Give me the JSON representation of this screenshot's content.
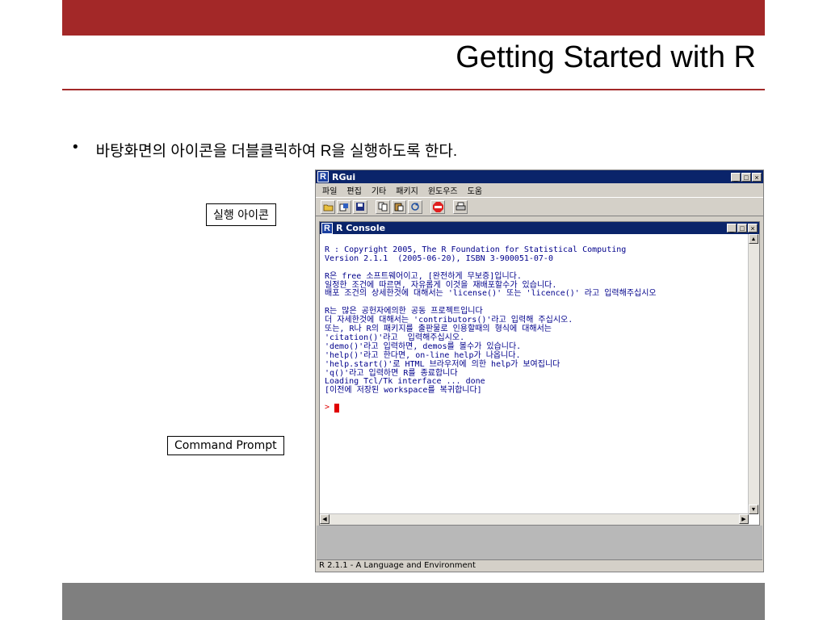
{
  "slide": {
    "title": "Getting Started with R",
    "bullet_mark": "•",
    "bullet_text": "바탕화면의 아이콘을 더블클릭하여 R을 실행하도록 한다.",
    "callout_icon": "실행 아이콘",
    "callout_prompt": "Command Prompt"
  },
  "colors": {
    "accent": "#a32828",
    "footer": "#7f7f7f",
    "console_text": "#00008b",
    "prompt": "#e00000"
  },
  "rgui": {
    "title": "RGui",
    "logo": "R",
    "min": "_",
    "max": "□",
    "close": "×",
    "menu": [
      "파일",
      "편집",
      "기타",
      "패키지",
      "윈도우즈",
      "도움"
    ],
    "toolbar_icons": [
      "open-script-icon",
      "load-workspace-icon",
      "save-icon",
      "copy-icon",
      "paste-icon",
      "refresh-icon",
      "stop-icon",
      "print-icon"
    ],
    "console": {
      "title": "R Console",
      "lines": [
        "",
        "R : Copyright 2005, The R Foundation for Statistical Computing",
        "Version 2.1.1  (2005-06-20), ISBN 3-900051-07-0",
        "",
        "R은 free 소프트웨어이고, [완전하게 무보증]입니다.",
        "일정한 조건에 따르면, 자유롭게 이것을 재배포할수가 있습니다.",
        "배포 조건의 상세한것에 대해서는 'license()' 또는 'licence()' 라고 입력해주십시오",
        "",
        "R는 많은 공헌자에의한 공동 프로젝트입니다",
        "더 자세한것에 대해서는 'contributors()'라고 입력해 주십시오.",
        "또는, R나 R의 패키지를 출판물로 인용할때의 형식에 대해서는",
        "'citation()'라고  입력해주십시오.",
        "'demo()'라고 입력하면, demos를 볼수가 있습니다.",
        "'help()'라고 한다면, on-line help가 나옵니다.",
        "'help.start()'로 HTML 브라우저에 의한 help가 보여집니다",
        "'q()'라고 입력하면 R를 종료합니다",
        "Loading Tcl/Tk interface ... done",
        "[이전에 저장된 workspace를 복귀합니다]"
      ],
      "prompt": ">"
    },
    "status": "R 2.1.1 - A Language and Environment"
  }
}
